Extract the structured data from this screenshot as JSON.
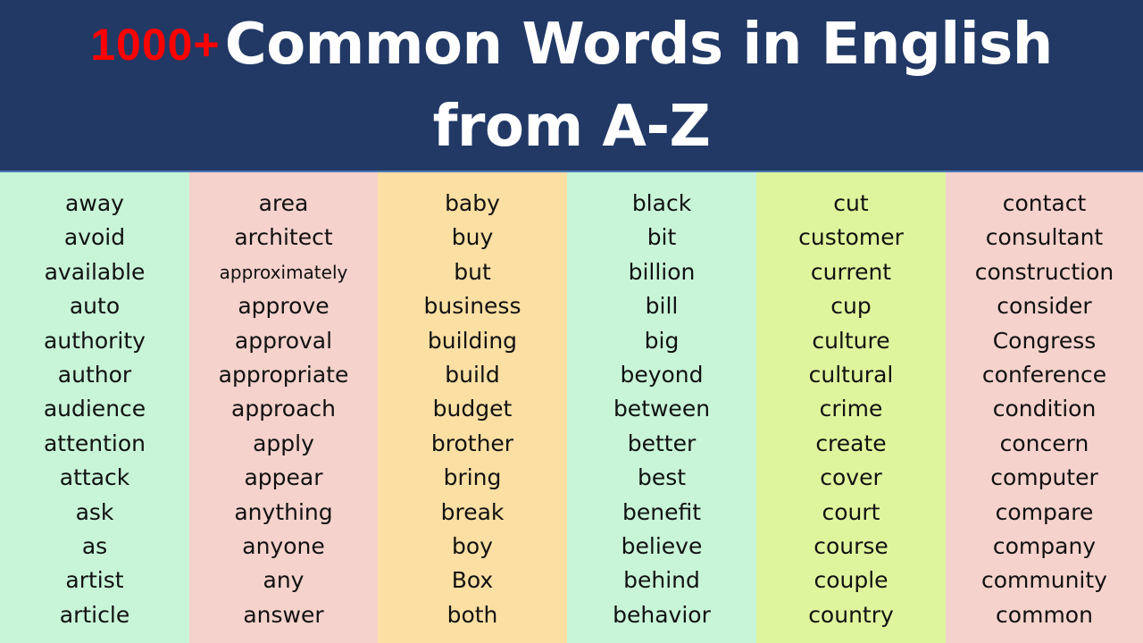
{
  "header": {
    "count": "1000+",
    "title_line1": "Common Words in English",
    "title_line2": "from A-Z",
    "background_color": "#223966",
    "count_color": "#ff0000",
    "title_color": "#ffffff"
  },
  "columns": [
    {
      "color": "#c8f5d8",
      "words": [
        "away",
        "avoid",
        "available",
        "auto",
        "authority",
        "author",
        "audience",
        "attention",
        "attack",
        "ask",
        "as",
        "artist",
        "article"
      ]
    },
    {
      "color": "#f5d2cc",
      "words": [
        "area",
        "architect",
        "approximately",
        "approve",
        "approval",
        "appropriate",
        "approach",
        "apply",
        "appear",
        "anything",
        "anyone",
        "any",
        "answer"
      ]
    },
    {
      "color": "#fbdfa3",
      "words": [
        "baby",
        "buy",
        "but",
        "business",
        "building",
        "build",
        "budget",
        "brother",
        "bring",
        "break",
        "boy",
        "Box",
        "both"
      ]
    },
    {
      "color": "#c8f5d8",
      "words": [
        "black",
        "bit",
        "billion",
        "bill",
        "big",
        "beyond",
        "between",
        "better",
        "best",
        "benefit",
        "believe",
        "behind",
        "behavior"
      ]
    },
    {
      "color": "#dff59d",
      "words": [
        "cut",
        "customer",
        "current",
        "cup",
        "culture",
        "cultural",
        "crime",
        "create",
        "cover",
        "court",
        "course",
        "couple",
        "country"
      ]
    },
    {
      "color": "#f5d2cc",
      "words": [
        "contact",
        "consultant",
        "construction",
        "consider",
        "Congress",
        "conference",
        "condition",
        "concern",
        "computer",
        "compare",
        "company",
        "community",
        "common"
      ]
    }
  ]
}
